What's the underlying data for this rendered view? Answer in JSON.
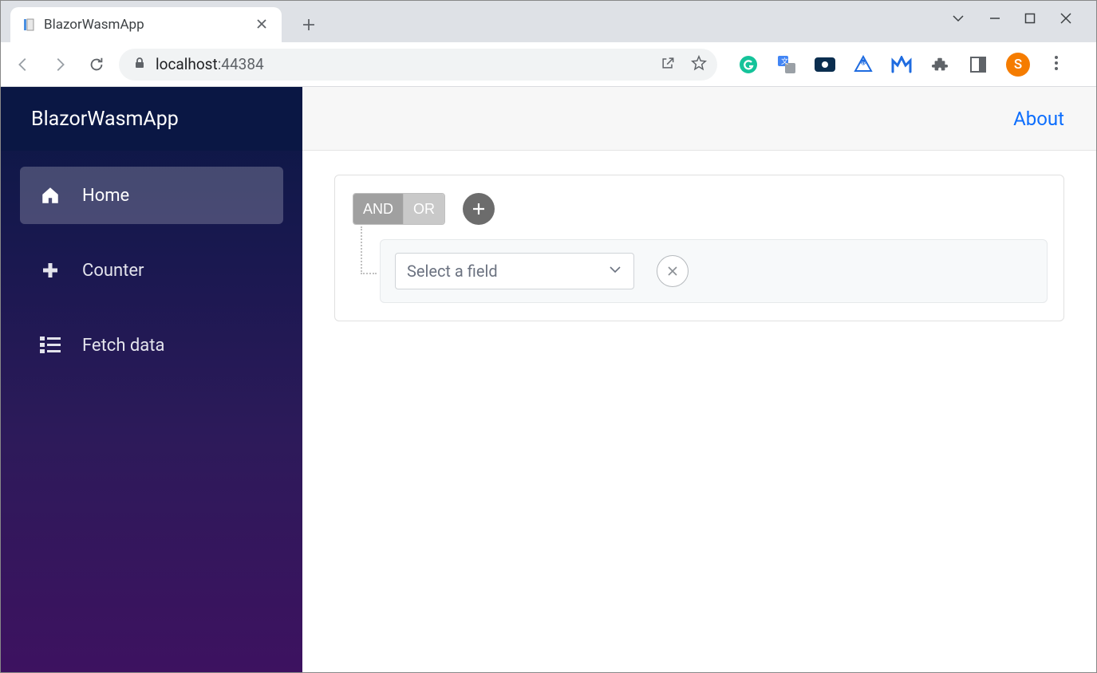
{
  "browser": {
    "tab_title": "BlazorWasmApp",
    "url_host": "localhost",
    "url_port": ":44384",
    "avatar_letter": "S"
  },
  "sidebar": {
    "brand": "BlazorWasmApp",
    "items": [
      {
        "label": "Home",
        "icon": "home",
        "active": true
      },
      {
        "label": "Counter",
        "icon": "plus",
        "active": false
      },
      {
        "label": "Fetch data",
        "icon": "list",
        "active": false
      }
    ]
  },
  "topbar": {
    "about": "About"
  },
  "query_builder": {
    "and_label": "AND",
    "or_label": "OR",
    "field_placeholder": "Select a field"
  }
}
